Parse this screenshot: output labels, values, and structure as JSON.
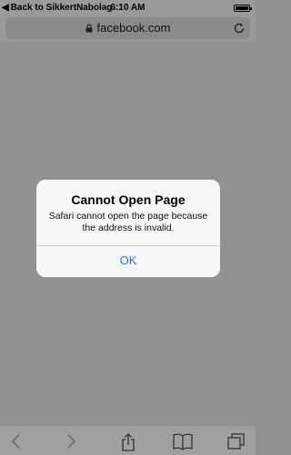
{
  "status_bar": {
    "back_label": "Back to SikkertNabolag…",
    "time": "6:10 AM"
  },
  "url_bar": {
    "domain": "facebook.com"
  },
  "alert": {
    "title": "Cannot Open Page",
    "message": "Safari cannot open the page because the address is invalid.",
    "button_label": "OK"
  },
  "toolbar": {
    "items": [
      "back-icon",
      "forward-icon",
      "share-icon",
      "bookmarks-icon",
      "tabs-icon"
    ]
  },
  "colors": {
    "overlay_background": "#919191",
    "alert_background": "#f7f7f7",
    "accent": "#1a7cf0"
  }
}
